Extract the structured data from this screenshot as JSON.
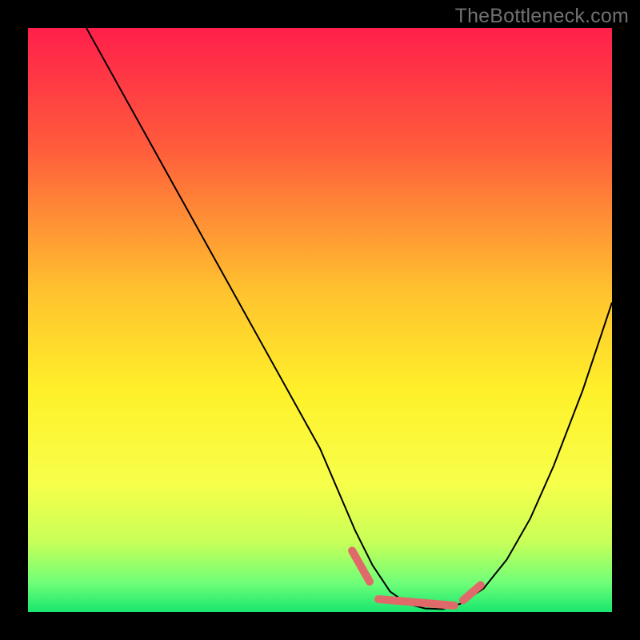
{
  "watermark": "TheBottleneck.com",
  "chart_data": {
    "type": "line",
    "title": "",
    "xlabel": "",
    "ylabel": "",
    "xlim": [
      0,
      100
    ],
    "ylim": [
      0,
      100
    ],
    "grid": false,
    "legend": false,
    "background_gradient": {
      "stops": [
        {
          "offset": 0.0,
          "color": "#ff1f4b"
        },
        {
          "offset": 0.2,
          "color": "#ff5a3c"
        },
        {
          "offset": 0.45,
          "color": "#ffc22e"
        },
        {
          "offset": 0.62,
          "color": "#fff02a"
        },
        {
          "offset": 0.78,
          "color": "#f7ff4a"
        },
        {
          "offset": 0.88,
          "color": "#c8ff58"
        },
        {
          "offset": 0.95,
          "color": "#6fff78"
        },
        {
          "offset": 1.0,
          "color": "#18e66f"
        }
      ]
    },
    "series": [
      {
        "name": "curve",
        "color": "#000000",
        "width": 2.0,
        "x": [
          10,
          15,
          20,
          25,
          30,
          35,
          40,
          45,
          50,
          53,
          56,
          59,
          62,
          65,
          68,
          71,
          74,
          78,
          82,
          86,
          90,
          95,
          100
        ],
        "y": [
          100,
          91,
          82,
          73,
          64,
          55,
          46,
          37,
          28,
          21,
          14,
          8,
          3.5,
          1.4,
          0.6,
          0.5,
          1.4,
          4,
          9,
          16,
          25,
          38,
          53
        ]
      },
      {
        "name": "bottom-highlight",
        "color": "#e06a6a",
        "width": 10,
        "linecap": "round",
        "segments": [
          {
            "x": [
              55.5,
              58.5
            ],
            "y": [
              10.5,
              5.2
            ]
          },
          {
            "x": [
              60.0,
              73.0
            ],
            "y": [
              2.2,
              1.1
            ]
          },
          {
            "x": [
              74.5,
              77.5
            ],
            "y": [
              2.0,
              4.6
            ]
          }
        ]
      }
    ]
  }
}
